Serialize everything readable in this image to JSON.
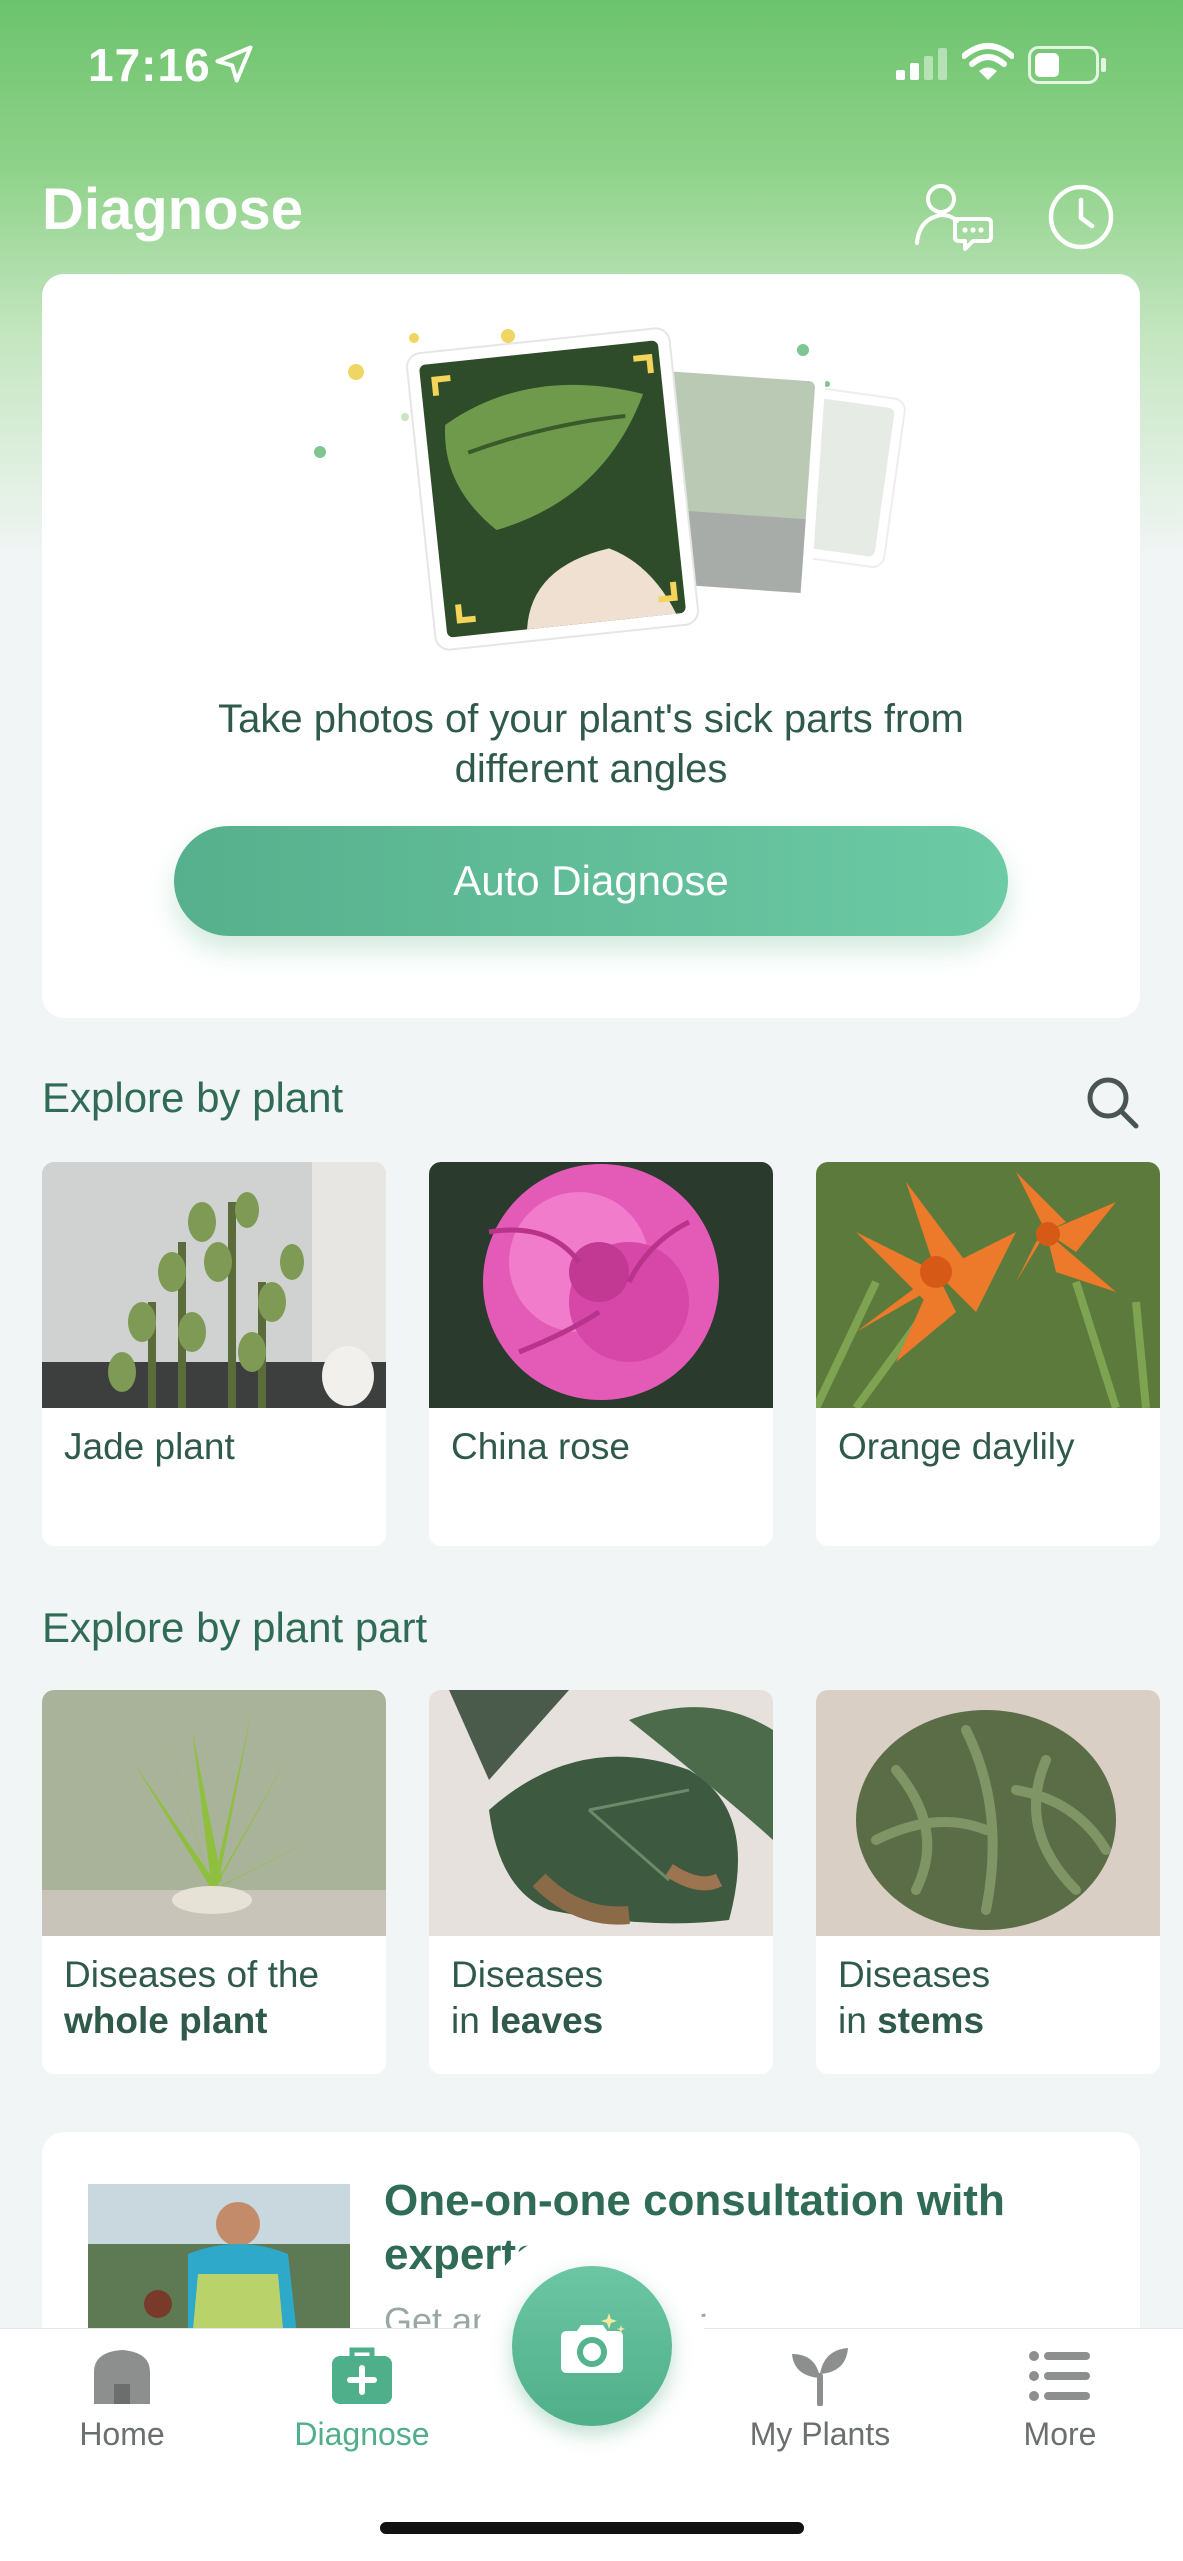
{
  "status_bar": {
    "time": "17:16"
  },
  "header": {
    "title": "Diagnose"
  },
  "hero": {
    "text": "Take photos of your plant's sick parts from different angles",
    "button_label": "Auto Diagnose"
  },
  "explore_plant": {
    "title": "Explore by plant",
    "items": [
      {
        "label": "Jade plant"
      },
      {
        "label": "China rose"
      },
      {
        "label": "Orange daylily"
      }
    ]
  },
  "explore_part": {
    "title": "Explore by plant part",
    "items": [
      {
        "line1": "Diseases of the",
        "line2": "whole plant"
      },
      {
        "line1": "Diseases",
        "line2a": "in ",
        "line2b": "leaves"
      },
      {
        "line1": "Diseases",
        "line2a": "in ",
        "line2b": "stems"
      }
    ]
  },
  "consultation": {
    "title": "One-on-one consultation with experts",
    "subtitle": "Get answers to your"
  },
  "tabbar": {
    "home": "Home",
    "diagnose": "Diagnose",
    "my_plants": "My Plants",
    "more": "More"
  },
  "colors": {
    "accent": "#4eaf8a",
    "header_green": "#6cc36d",
    "text_dark": "#2f5a4a"
  }
}
